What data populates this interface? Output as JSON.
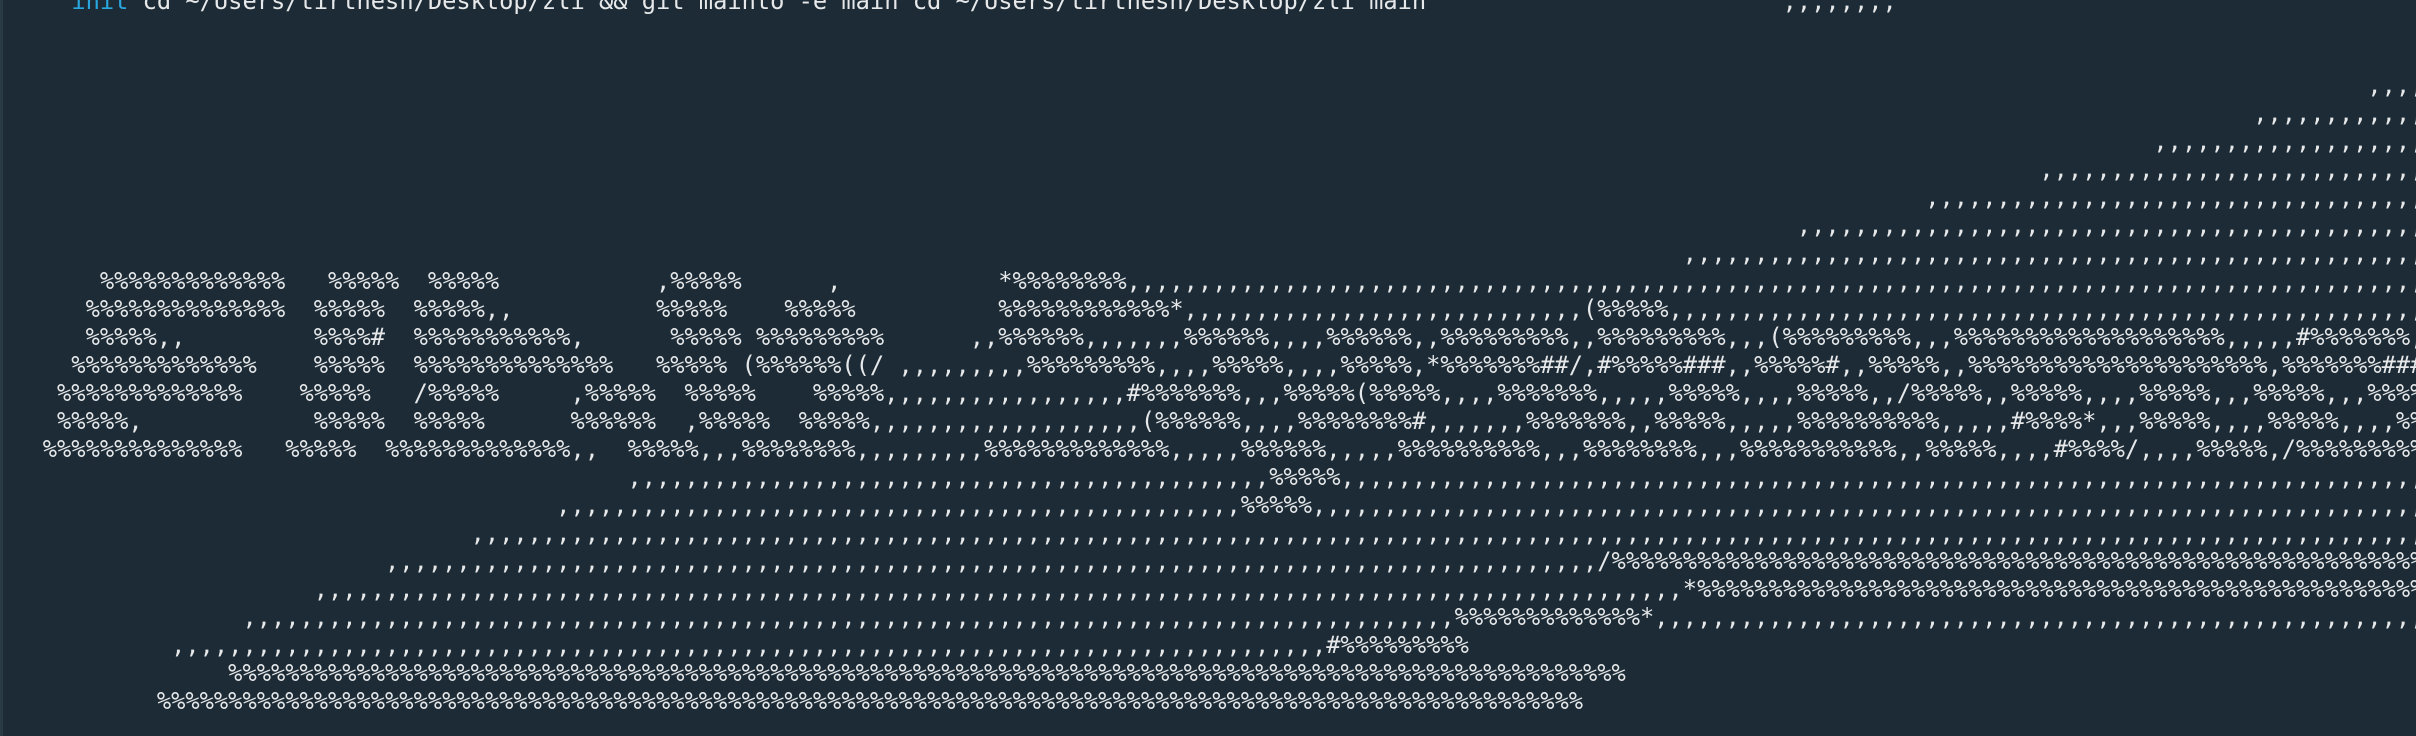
{
  "terminal": {
    "prompt_line": {
      "prefix": "     ",
      "keyword": "init",
      "command": " cd ~/Users/tirthesh/Desktop/zli && git mainto -e main cd ~/Users/tirthesh/Desktop/zli main",
      "tail": "                         ,,,,,,,,"
    },
    "ascii_lines": [
      "                                                                                                                                                                                     ,,,,,,,,,,,,,,,,,",
      "                                                                                                                                                                              ,,,,,,,,,,,,,,,,,,,,,,,,,,",
      "                                                                                                                                                                      ,,,,,,,,,,,,,,,,,,,,,,,,,,,,,,,,,,,",
      "                                                                                                                                                              ,,,,,,,,,,,,,,,,,,,,,,,,,,,,,,,,,,,,,,,,,,,,",
      "                                                                                                                                                       ,,,,,,,,,,,,,,,,,,,,,,,,,,,,,,,,,,,,,,,,,,,,,,,,,,,,",
      "                                                                                                                                               ,,,,,,,,,,,,,,,,,,,,,,,,,,,,,,,,,,,,,,,,,,,,,,,,,,,,,,,,,,,,,",
      "                                                                                                                                       ,,,,,,,,,,,,,,,,,,,,,,,,,,,,,,,,,,,,,,,,,,,,,,,,,,,,,,,,,,,,,,,,,,,,",
      "                                                                                                                              ,,,,,,,,,,,,,,,,,,,,,,,,,,,,,,,,,,,,,,,,,,,,,,,,,,,,,,,,,,,,,,,,,,,,,,,,,,,,,,",
      "                                                                                                                      ,,,,,,,,,,,,,,,,,,,,,,,,,,,,,,,,,,,,,,,,,,,,,,,,,,,,,,,,,,,,,,,,,,,,,,,,,,,,,,,,,,,,,,,,,,",
      "       %%%%%%%%%%%%%   %%%%%  %%%%%           ,%%%%%      ,           *%%%%%%%%,,,,,,,,,,,,,,,,,,,,,,,,,,,,,,,,,,,,,,,,,,,,,,,,,,,,,,,,,,,,,,,,,,,,,,,,,,,,,,,,,,,,,,,,,,,,",
      "      %%%%%%%%%%%%%%  %%%%%  %%%%%,,          %%%%%    %%%%%          %%%%%%%%%%%%*,,,,,,,,,,,,,,,,,,,,,,,,,,,,(%%%%%,,,,,,,,,,,,,,,,,,,,,,,,,,,,,,,,,,,,,,,,,,,,,,,,,,,,,,,,,,",
      "      %%%%%,,         %%%%#  %%%%%%%%%%%,      %%%%% %%%%%%%%%      ,,%%%%%%,,,,,,,%%%%%%,,,,%%%%%%,,%%%%%%%%%,,%%%%%%%%%,,,(%%%%%%%%%,,,%%%%%%%%%%%%%%%%%%%,,,,,#%%%%%%%,",
      "     %%%%%%%%%%%%%    %%%%%  %%%%%%%%%%%%%%   %%%%% (%%%%%%((/ ,,,,,,,,,%%%%%%%%%,,,,%%%%%,,,,%%%%%,*%%%%%%%##/,#%%%%%###,,%%%%%#,,%%%%%,,%%%%%%%%%%%%%%%%%%%%%,%%%%%%%###,",
      "    %%%%%%%%%%%%%    %%%%%   /%%%%%     ,%%%%%  %%%%%    %%%%%,,,,,,,,,,,,,,,,,#%%%%%%%,,,%%%%%(%%%%%,,,,%%%%%%%,,,,,%%%%%,,,,%%%%%,,/%%%%%,,%%%%%,,,,%%%%%,,,%%%%%,,,%%%%%%,,,",
      "    %%%%%,            %%%%%  %%%%%      %%%%%%  ,%%%%%  %%%%%,,,,,,,,,,,,,,,,,,,(%%%%%%,,,,%%%%%%%%#,,,,,,,%%%%%%%,,%%%%%,,,,,%%%%%%%%%%,,,,,#%%%%*,,,%%%%%,,,,%%%%%,,,,%%%%%%,,",
      "   %%%%%%%%%%%%%%   %%%%%  %%%%%%%%%%%%%,,  %%%%%,,,%%%%%%%%,,,,,,,,,%%%%%%%%%%%%%,,,,,%%%%%%,,,,,%%%%%%%%%%,,,%%%%%%%%,,,%%%%%%%%%%%,,%%%%%,,,,#%%%%/,,,,%%%%%,/%%%%%%%%%%,,",
      "                                            ,,,,,,,,,,,,,,,,,,,,,,,,,,,,,,,,,,,,,,,,,,,,,%%%%%,,,,,,,,,,,,,,,,,,,,,,,,,,,,,,,,,,,,,,,,,,,,,,,,,,,,,,,,,,,,,,,,,,,,,,,,,,,,,,,,,,,,,,,,",
      "                                       ,,,,,,,,,,,,,,,,,,,,,,,,,,,,,,,,,,,,,,,,,,,,,,,,%%%%%,,,,,,,,,,,,,,,,,,,,,,,,,,,,,,,,,,,,,,,,,,,,,,,,,,,,,,,,,,,,,,,,,,,,,,,,,,,,,,,,,,,,,,,,,",
      "                                 ,,,,,,,,,,,,,,,,,,,,,,,,,,,,,,,,,,,,,,,,,,,,,,,,,,,,,,,,,,,,,,,,,,,,,,,,,,,,,,,,,,,,,,,,,,,,,,,,,,,,,,,,,,,,,,,,,,,,,,,,,,,,,,,,,,,,,,,,,,,,,,,,,,,,,,",
      "                           ,,,,,,,,,,,,,,,,,,,,,,,,,,,,,,,,,,,,,,,,,,,,,,,,,,,,,,,,,,,,,,,,,,,,,,,,,,,,,,,,,,,,,/%%%%%%%%%%%%%%%%%%%%%%%%%%%%%%%%%%%%%%%%%%%%%%%%%%%%%%%%%%%%%%%%%%%%%%%%%",
      "                      ,,,,,,,,,,,,,,,,,,,,,,,,,,,,,,,,,,,,,,,,,,,,,,,,,,,,,,,,,,,,,,,,,,,,,,,,,,,,,,,,,,,,,,,,,,,,,,,,*%%%%%%%%%%%%%%%%%%%%%%%%%%%%%%%%%%%%%%%%%%%%%%%%%%%%%%%%%%%%%%%%%%%",
      "                 ,,,,,,,,,,,,,,,,,,,,,,,,,,,,,,,,,,,,,,,,,,,,,,,,,,,,,,,,,,,,,,,,,,,,,,,,,,,,,,,,,,,,,%%%%%%%%%%%%%*,,,,,,,,,,,,,,,,,,,,,,,,,,,,,,,,,,,,,,,,,,,,,,,,,,,,,,,,,,,,,,,,,,,,,,",
      "            ,,,,,,,,,,,,,,,,,,,,,,,,,,,,,,,,,,,,,,,,,,,,,,,,,,,,,,,,,,,,,,,,,,,,,,,,,,,,,,,,,#%%%%%%%%%",
      "                %%%%%%%%%%%%%%%%%%%%%%%%%%%%%%%%%%%%%%%%%%%%%%%%%%%%%%%%%%%%%%%%%%%%%%%%%%%%%%%%%%%%%%%%%%%%%%%%%%",
      "           %%%%%%%%%%%%%%%%%%%%%%%%%%%%%%%%%%%%%%%%%%%%%%%%%%%%%%%%%%%%%%%%%%%%%%%%%%%%%%%%%%%%%%%%%%%%%%%%%%%%"
    ]
  }
}
